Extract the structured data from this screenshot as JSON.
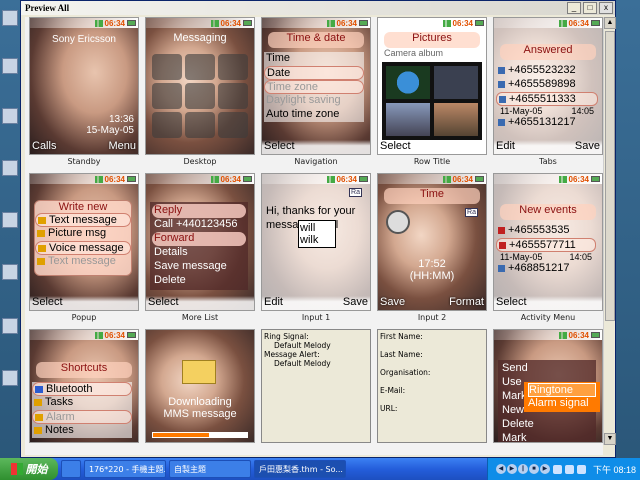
{
  "window": {
    "title": "Preview All",
    "buttons": {
      "min": "_",
      "max": "□",
      "close": "x"
    }
  },
  "status_time": "06:34",
  "cells": {
    "standby": {
      "caption": "Standby",
      "brand": "Sony Ericsson",
      "time": "13:36",
      "date": "15-May-05",
      "left": "Calls",
      "right": "Menu"
    },
    "desktop": {
      "caption": "Desktop",
      "title": "Messaging"
    },
    "navigation": {
      "caption": "Navigation",
      "header": "Time & date",
      "items": [
        "Time",
        "Date",
        "Time zone",
        "Daylight saving",
        "Auto time zone"
      ],
      "left": "Select"
    },
    "rowtitle": {
      "caption": "Row Title",
      "header": "Pictures",
      "sub": "Camera album",
      "left": "Select"
    },
    "tabs": {
      "caption": "Tabs",
      "header": "Answered",
      "numbers": [
        "+4655523232",
        "+4655589898",
        "+4655511333",
        "+4655131217"
      ],
      "date": "11-May-05",
      "time": "14:05",
      "left": "Edit",
      "right": "Save"
    },
    "popup": {
      "caption": "Popup",
      "title": "Write new",
      "items": [
        "Text message",
        "Picture msg",
        "Voice message",
        "Text message"
      ],
      "left": "Select"
    },
    "morelist": {
      "caption": "More List",
      "items": [
        "Reply",
        "Call +440123456",
        "Forward",
        "Details",
        "Save message",
        "Delete"
      ],
      "left": "Select"
    },
    "input1": {
      "caption": "Input 1",
      "text": "Hi, thanks for your message. I will",
      "suggestions": [
        "will",
        "wilk"
      ],
      "ra": "Ra",
      "left": "Edit",
      "right": "Save"
    },
    "input2": {
      "caption": "Input 2",
      "header": "Time",
      "time": "17:52",
      "format": "(HH:MM)",
      "ra": "Ra",
      "left": "Save",
      "right": "Format"
    },
    "activity": {
      "caption": "Activity Menu",
      "header": "New events",
      "numbers": [
        "+465553535",
        "+4655577711",
        "+468851217"
      ],
      "date": "11-May-05",
      "time": "14:05",
      "left": "Select"
    },
    "shortcuts": {
      "header": "Shortcuts",
      "items": [
        "Bluetooth",
        "Tasks",
        "Alarm",
        "Notes"
      ]
    },
    "download": {
      "line1": "Downloading",
      "line2": "MMS message",
      "progress": 0.6
    },
    "ringsignal": {
      "lines": [
        "Ring Signal:",
        "Default Melody",
        "Message Alert:",
        "Default Melody"
      ]
    },
    "contact": {
      "lines": [
        "First Name:",
        "Last Name:",
        "Organisation:",
        "E-Mail:",
        "URL:"
      ]
    },
    "send": {
      "items": [
        "Send",
        "Use",
        "Mark",
        "New",
        "Delete",
        "Mark"
      ],
      "submenu": [
        "Ringtone",
        "Alarm signal"
      ]
    }
  },
  "taskbar": {
    "start": "開始",
    "buttons": [
      "176*220 - 手機主題...",
      "自製主題",
      "戶田惠梨香.thm - So..."
    ],
    "clock": "下午 08:18"
  }
}
